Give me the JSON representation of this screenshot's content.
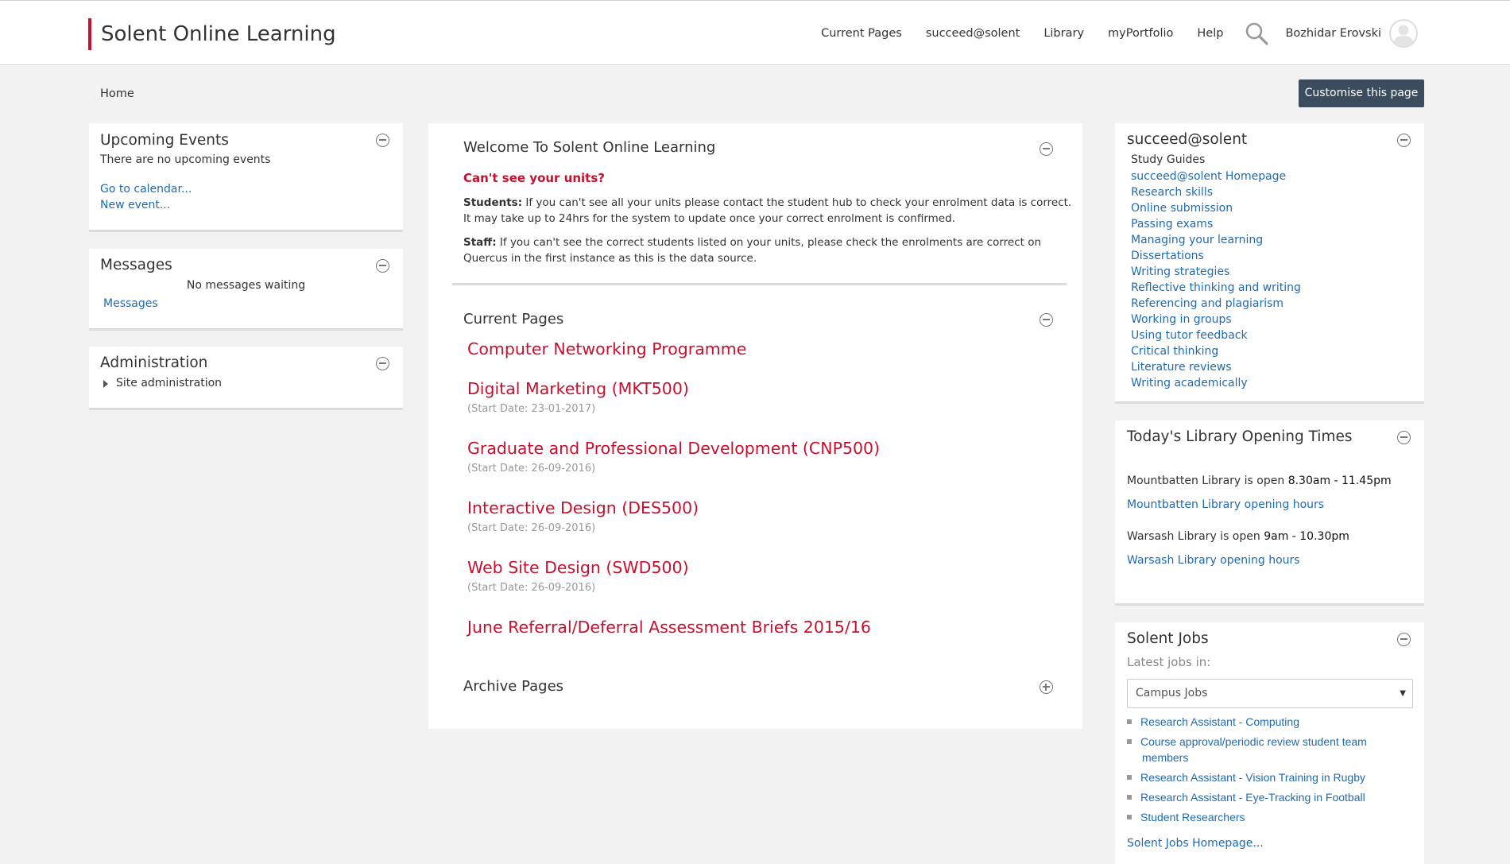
{
  "header": {
    "brand": "Solent Online Learning",
    "nav": [
      "Current Pages",
      "succeed@solent",
      "Library",
      "myPortfolio",
      "Help"
    ],
    "user_name": "Bozhidar Erovski"
  },
  "breadcrumb": "Home",
  "customise_button": "Customise this page",
  "upcoming_events": {
    "title": "Upcoming Events",
    "empty_text": "There are no upcoming events",
    "links": [
      "Go to calendar...",
      "New event..."
    ]
  },
  "messages": {
    "title": "Messages",
    "empty_text": "No messages waiting",
    "link": "Messages"
  },
  "administration": {
    "title": "Administration",
    "item": "Site administration"
  },
  "welcome": {
    "title": "Welcome To Solent Online Learning",
    "subheading": "Can't see your units?",
    "students_label": "Students:",
    "students_line1": " If you can't see all your units please contact the student hub to check your enrolment data is correct.",
    "students_line2": "It may take up to 24hrs for the system to update once your correct enrolment is confirmed.",
    "staff_label": "Staff:",
    "staff_line1": " If you can't see the correct students listed on your units, please check the enrolments are correct on",
    "staff_line2": "Quercus in the first instance as this is the data source."
  },
  "current_pages": {
    "title": "Current Pages",
    "items": [
      {
        "name": "Computer Networking Programme",
        "date": ""
      },
      {
        "name": "Digital Marketing (MKT500)",
        "date": "(Start Date: 23-01-2017)"
      },
      {
        "name": "Graduate and Professional Development (CNP500)",
        "date": "(Start Date: 26-09-2016)"
      },
      {
        "name": "Interactive Design (DES500)",
        "date": "(Start Date: 26-09-2016)"
      },
      {
        "name": "Web Site Design (SWD500)",
        "date": "(Start Date: 26-09-2016)"
      },
      {
        "name": "June Referral/Deferral Assessment Briefs 2015/16",
        "date": ""
      }
    ]
  },
  "archive_pages": {
    "title": "Archive Pages"
  },
  "succeed": {
    "title": "succeed@solent",
    "subheading": "Study Guides",
    "links": [
      "succeed@solent Homepage",
      "Research skills",
      "Online submission",
      "Passing exams",
      "Managing your learning",
      "Dissertations",
      "Writing strategies",
      "Reflective thinking and writing",
      "Referencing and plagiarism",
      "Working in groups",
      "Using tutor feedback",
      "Critical thinking",
      "Literature reviews",
      "Writing academically"
    ]
  },
  "library": {
    "title": "Today's Library Opening Times",
    "mountbatten_text": "Mountbatten Library is open ",
    "mountbatten_hours": "8.30am - 11.45pm",
    "mountbatten_link": "Mountbatten Library opening hours",
    "warsash_text": "Warsash Library is open ",
    "warsash_hours": "9am - 10.30pm",
    "warsash_link": "Warsash Library opening hours"
  },
  "jobs": {
    "title": "Solent Jobs",
    "subheading": "Latest jobs in:",
    "selected": "Campus Jobs",
    "items": [
      "Research Assistant - Computing",
      "Course approval/periodic review student team",
      "members",
      "Research Assistant - Vision Training in Rugby",
      "Research Assistant - Eye-Tracking in Football",
      "Student Researchers"
    ],
    "homepage_link": "Solent Jobs Homepage..."
  },
  "colors": {
    "accent_red": "#c8102e",
    "link_blue": "#1f6bb0",
    "button_dark": "#3a4c5d"
  }
}
